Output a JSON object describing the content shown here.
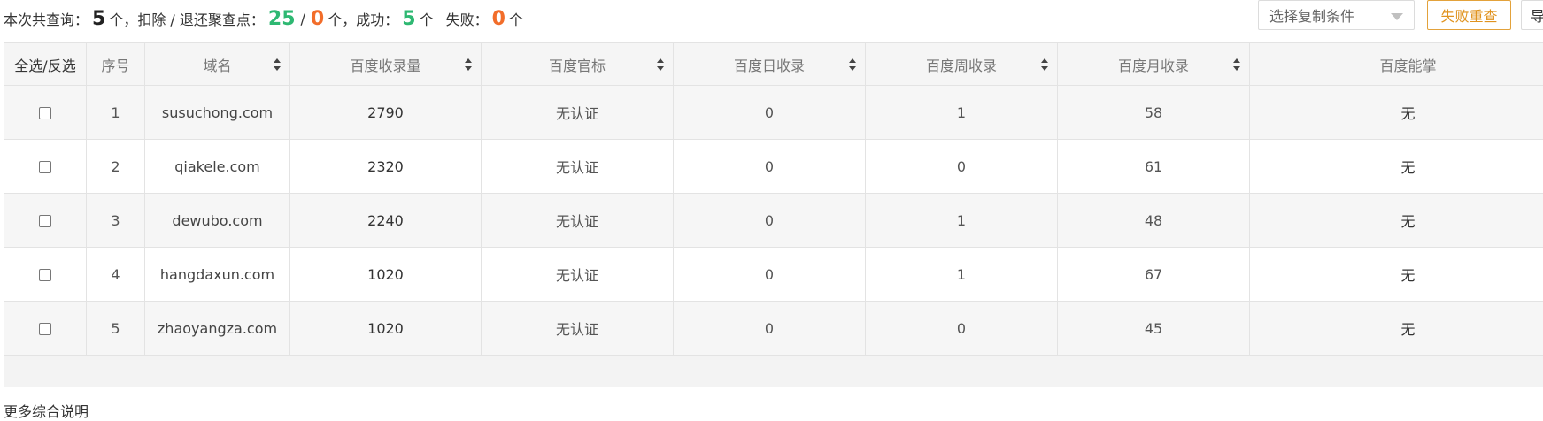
{
  "summary": {
    "label_total": "本次共查询：",
    "total": "5",
    "unit1": "个，扣除 / 退还聚查点：",
    "deduct": "25",
    "slash": "/",
    "refund": "0",
    "unit2": "个，成功：",
    "success": "5",
    "unit3": "个",
    "fail_label": "失败：",
    "fail": "0",
    "unit4": "个"
  },
  "toolbar": {
    "select_placeholder": "选择复制条件",
    "retry_label": "失败重查",
    "export_label": "导"
  },
  "table": {
    "headers": [
      "全选/反选",
      "序号",
      "域名",
      "百度收录量",
      "百度官标",
      "百度日收录",
      "百度周收录",
      "百度月收录",
      "百度能掌"
    ],
    "rows": [
      {
        "index": "1",
        "domain": "susuchong.com",
        "indexed": "2790",
        "official": "无认证",
        "daily": "0",
        "weekly": "1",
        "monthly": "58",
        "xzh": "无"
      },
      {
        "index": "2",
        "domain": "qiakele.com",
        "indexed": "2320",
        "official": "无认证",
        "daily": "0",
        "weekly": "0",
        "monthly": "61",
        "xzh": "无"
      },
      {
        "index": "3",
        "domain": "dewubo.com",
        "indexed": "2240",
        "official": "无认证",
        "daily": "0",
        "weekly": "1",
        "monthly": "48",
        "xzh": "无"
      },
      {
        "index": "4",
        "domain": "hangdaxun.com",
        "indexed": "1020",
        "official": "无认证",
        "daily": "0",
        "weekly": "1",
        "monthly": "67",
        "xzh": "无"
      },
      {
        "index": "5",
        "domain": "zhaoyangza.com",
        "indexed": "1020",
        "official": "无认证",
        "daily": "0",
        "weekly": "0",
        "monthly": "45",
        "xzh": "无"
      }
    ]
  },
  "footer": {
    "note": "更多综合说明"
  }
}
